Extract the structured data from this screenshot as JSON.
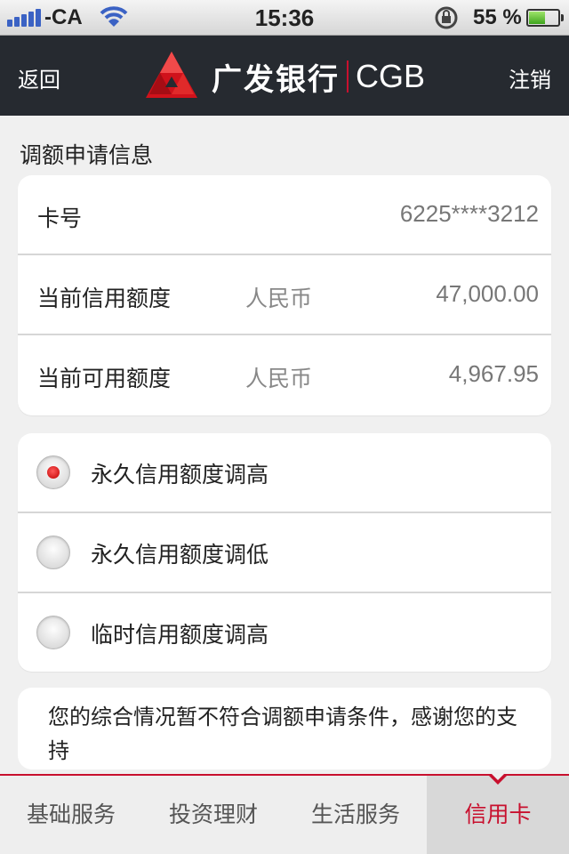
{
  "status_bar": {
    "carrier": "-CA",
    "time": "15:36",
    "battery_percent": "55 %",
    "battery_level": 0.55
  },
  "nav": {
    "back_label": "返回",
    "brand_cn": "广发银行",
    "brand_en": "CGB",
    "logout_label": "注销"
  },
  "section_title": "调额申请信息",
  "info_rows": [
    {
      "label": "卡号",
      "unit": "",
      "value": "6225****3212"
    },
    {
      "label": "当前信用额度",
      "unit": "人民币",
      "value": "47,000.00"
    },
    {
      "label": "当前可用额度",
      "unit": "人民币",
      "value": "4,967.95"
    }
  ],
  "options": [
    {
      "label": "永久信用额度调高",
      "checked": true
    },
    {
      "label": "永久信用额度调低",
      "checked": false
    },
    {
      "label": "临时信用额度调高",
      "checked": false
    }
  ],
  "notice": "您的综合情况暂不符合调额申请条件，感谢您的支持",
  "tabs": [
    {
      "label": "基础服务",
      "active": false
    },
    {
      "label": "投资理财",
      "active": false
    },
    {
      "label": "生活服务",
      "active": false
    },
    {
      "label": "信用卡",
      "active": true
    }
  ],
  "colors": {
    "brand_red": "#c8102e",
    "nav_background": "#262a30"
  },
  "icons": {
    "signal": "signal-icon",
    "wifi": "wifi-icon",
    "rotation_lock": "rotation-lock-icon",
    "battery": "battery-icon",
    "logo": "cgb-logo-icon"
  }
}
